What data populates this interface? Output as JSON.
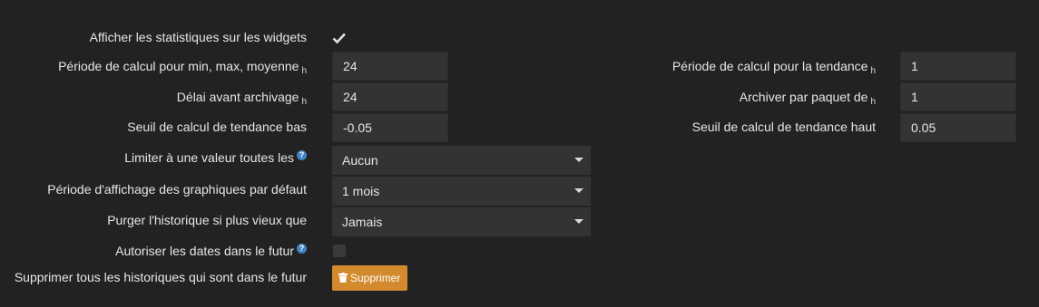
{
  "settings": {
    "show_widget_stats": {
      "label": "Afficher les statistiques sur les widgets",
      "checked": true
    },
    "minmax_period": {
      "label": "Période de calcul pour min, max, moyenne",
      "unit": "h",
      "value": "24"
    },
    "archive_delay": {
      "label": "Délai avant archivage",
      "unit": "h",
      "value": "24"
    },
    "trend_low": {
      "label": "Seuil de calcul de tendance bas",
      "value": "-0.05"
    },
    "limit_value": {
      "label": "Limiter à une valeur toutes les",
      "value": "Aucun"
    },
    "graph_period": {
      "label": "Période d'affichage des graphiques par défaut",
      "value": "1 mois"
    },
    "purge_history": {
      "label": "Purger l'historique si plus vieux que",
      "value": "Jamais"
    },
    "future_dates": {
      "label": "Autoriser les dates dans le futur",
      "checked": false
    },
    "delete_future": {
      "label": "Supprimer tous les historiques qui sont dans le futur",
      "button": "Supprimer"
    },
    "trend_period": {
      "label": "Période de calcul pour la tendance",
      "unit": "h",
      "value": "1"
    },
    "archive_batch": {
      "label": "Archiver par paquet de",
      "unit": "h",
      "value": "1"
    },
    "trend_high": {
      "label": "Seuil de calcul de tendance haut",
      "value": "0.05"
    }
  },
  "help_glyph": "?",
  "colors": {
    "background": "#222222",
    "input_bg": "#333333",
    "button": "#d38a2e",
    "help": "#3f82c4"
  }
}
